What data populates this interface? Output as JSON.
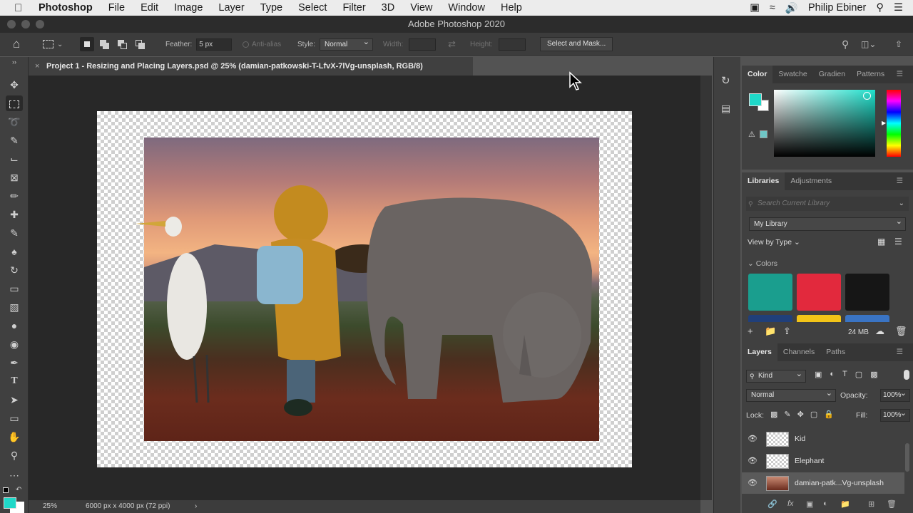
{
  "menubar": {
    "app_name": "Photoshop",
    "items": [
      "File",
      "Edit",
      "Image",
      "Layer",
      "Type",
      "Select",
      "Filter",
      "3D",
      "View",
      "Window",
      "Help"
    ],
    "user": "Philip Ebiner"
  },
  "window": {
    "title": "Adobe Photoshop 2020"
  },
  "options": {
    "feather_label": "Feather:",
    "feather_value": "5 px",
    "antialias_label": "Anti-alias",
    "style_label": "Style:",
    "style_value": "Normal",
    "width_label": "Width:",
    "height_label": "Height:",
    "select_mask_label": "Select and Mask..."
  },
  "document": {
    "tab_title": "Project 1 - Resizing and Placing Layers.psd @ 25% (damian-patkowski-T-LfvX-7lVg-unsplash, RGB/8)"
  },
  "status": {
    "zoom": "25%",
    "size": "6000 px x 4000 px (72 ppi)"
  },
  "color_panel": {
    "tabs": [
      "Color",
      "Swatche",
      "Gradien",
      "Patterns"
    ],
    "foreground": "#1fd8c8"
  },
  "libraries_panel": {
    "tabs": [
      "Libraries",
      "Adjustments"
    ],
    "search_placeholder": "Search Current Library",
    "library_name": "My Library",
    "view_by": "View by Type",
    "section_colors": "Colors",
    "storage": "24 MB",
    "colors": [
      "#1a9e8e",
      "#e2293d",
      "#161616",
      "#203f7a",
      "#f2c418",
      "#3a74c4"
    ]
  },
  "layers_panel": {
    "tabs": [
      "Layers",
      "Channels",
      "Paths"
    ],
    "filter_kind": "Kind",
    "blend_mode": "Normal",
    "opacity_label": "Opacity:",
    "opacity_value": "100%",
    "lock_label": "Lock:",
    "fill_label": "Fill:",
    "fill_value": "100%",
    "layers": [
      {
        "name": "Kid"
      },
      {
        "name": "Elephant"
      },
      {
        "name": "damian-patk...Vg-unsplash"
      }
    ]
  }
}
